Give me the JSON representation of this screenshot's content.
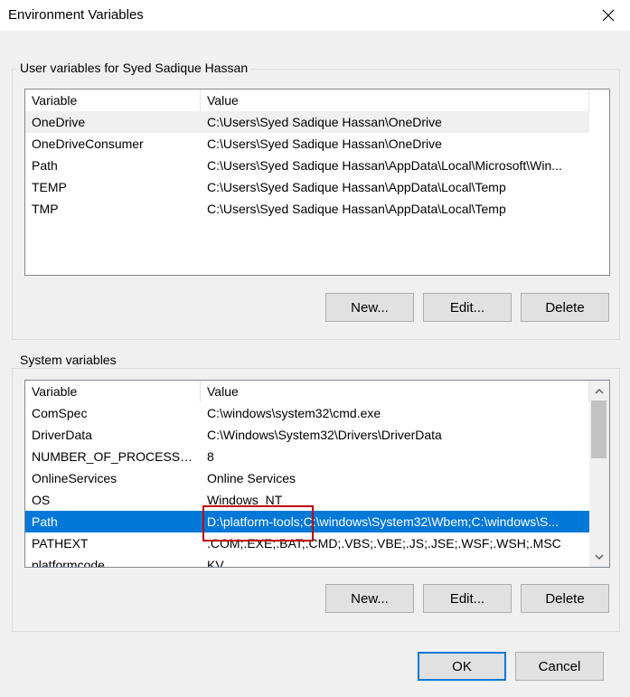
{
  "window": {
    "title": "Environment Variables"
  },
  "user_vars": {
    "label": "User variables for Syed Sadique Hassan",
    "columns": [
      "Variable",
      "Value"
    ],
    "rows": [
      {
        "variable": "OneDrive",
        "value": "C:\\Users\\Syed Sadique Hassan\\OneDrive"
      },
      {
        "variable": "OneDriveConsumer",
        "value": "C:\\Users\\Syed Sadique Hassan\\OneDrive"
      },
      {
        "variable": "Path",
        "value": "C:\\Users\\Syed Sadique Hassan\\AppData\\Local\\Microsoft\\Win..."
      },
      {
        "variable": "TEMP",
        "value": "C:\\Users\\Syed Sadique Hassan\\AppData\\Local\\Temp"
      },
      {
        "variable": "TMP",
        "value": "C:\\Users\\Syed Sadique Hassan\\AppData\\Local\\Temp"
      }
    ],
    "buttons": {
      "new": "New...",
      "edit": "Edit...",
      "delete": "Delete"
    }
  },
  "system_vars": {
    "label": "System variables",
    "columns": [
      "Variable",
      "Value"
    ],
    "rows": [
      {
        "variable": "ComSpec",
        "value": "C:\\windows\\system32\\cmd.exe"
      },
      {
        "variable": "DriverData",
        "value": "C:\\Windows\\System32\\Drivers\\DriverData"
      },
      {
        "variable": "NUMBER_OF_PROCESSORS",
        "value": "8"
      },
      {
        "variable": "OnlineServices",
        "value": "Online Services"
      },
      {
        "variable": "OS",
        "value": "Windows_NT"
      },
      {
        "variable": "Path",
        "value": "D:\\platform-tools;C:\\windows\\System32\\Wbem;C:\\windows\\S..."
      },
      {
        "variable": "PATHEXT",
        "value": ".COM;.EXE;.BAT;.CMD;.VBS;.VBE;.JS;.JSE;.WSF;.WSH;.MSC"
      },
      {
        "variable": "platformcode",
        "value": "KV"
      }
    ],
    "selected_row": 5,
    "buttons": {
      "new": "New...",
      "edit": "Edit...",
      "delete": "Delete"
    }
  },
  "footer": {
    "ok": "OK",
    "cancel": "Cancel"
  },
  "colors": {
    "selection": "#0078d7",
    "highlight_box": "#c00000",
    "face": "#f0f0f0"
  },
  "icons": {
    "close": "close-icon",
    "scroll_up": "chevron-up-icon",
    "scroll_down": "chevron-down-icon"
  }
}
